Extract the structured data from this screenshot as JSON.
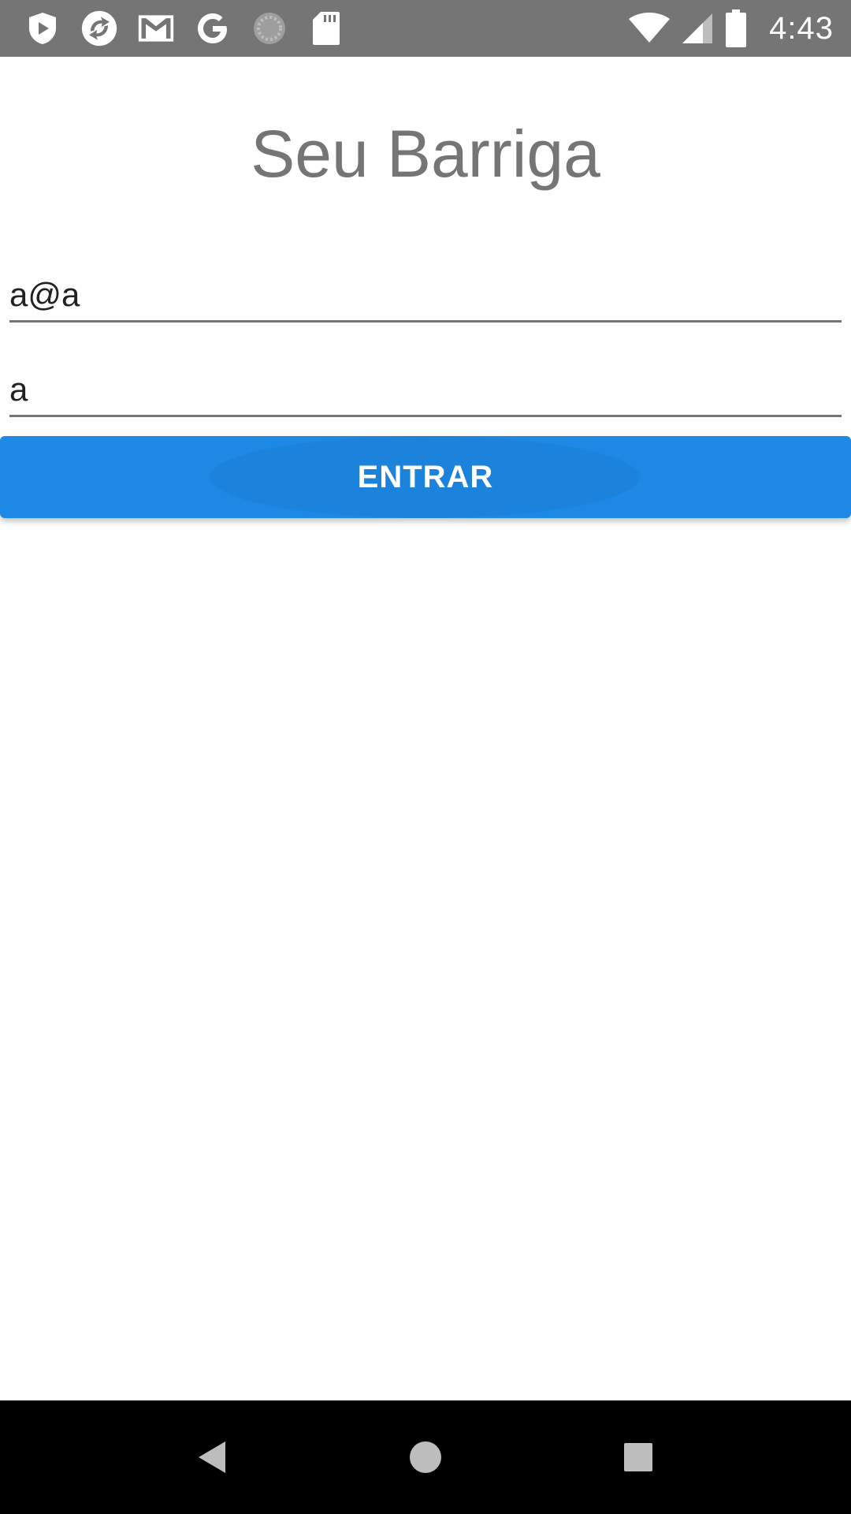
{
  "status_bar": {
    "time": "4:43",
    "left_icons": [
      "play-protect-icon",
      "sync-icon",
      "gmail-icon",
      "google-icon",
      "loading-icon",
      "sd-card-icon"
    ],
    "right_icons": [
      "wifi-icon",
      "cell-signal-icon",
      "battery-icon"
    ]
  },
  "app": {
    "title": "Seu Barriga"
  },
  "form": {
    "email_value": "a@a",
    "password_value": "a",
    "submit_label": "ENTRAR"
  },
  "colors": {
    "status_bar": "#757575",
    "accent": "#1e88e5",
    "title_text": "#757575",
    "nav_bar": "#000000"
  },
  "nav_bar": {
    "buttons": [
      "back-icon",
      "home-icon",
      "recents-icon"
    ]
  }
}
